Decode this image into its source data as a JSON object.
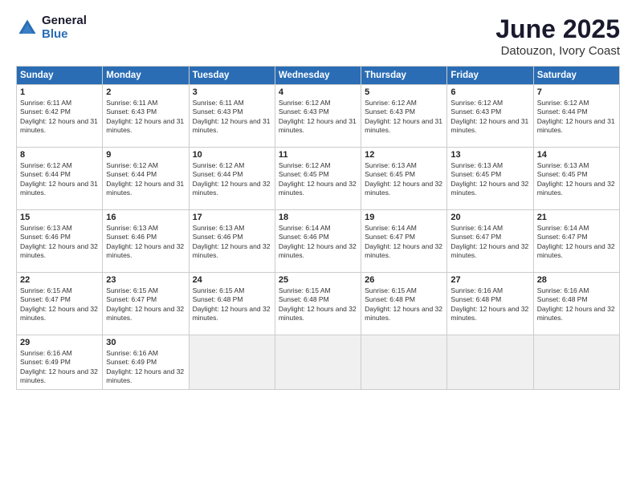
{
  "logo": {
    "general": "General",
    "blue": "Blue"
  },
  "title": "June 2025",
  "subtitle": "Datouzon, Ivory Coast",
  "days_of_week": [
    "Sunday",
    "Monday",
    "Tuesday",
    "Wednesday",
    "Thursday",
    "Friday",
    "Saturday"
  ],
  "weeks": [
    [
      {
        "day": "1",
        "sunrise": "6:11 AM",
        "sunset": "6:42 PM",
        "daylight": "12 hours and 31 minutes."
      },
      {
        "day": "2",
        "sunrise": "6:11 AM",
        "sunset": "6:43 PM",
        "daylight": "12 hours and 31 minutes."
      },
      {
        "day": "3",
        "sunrise": "6:11 AM",
        "sunset": "6:43 PM",
        "daylight": "12 hours and 31 minutes."
      },
      {
        "day": "4",
        "sunrise": "6:12 AM",
        "sunset": "6:43 PM",
        "daylight": "12 hours and 31 minutes."
      },
      {
        "day": "5",
        "sunrise": "6:12 AM",
        "sunset": "6:43 PM",
        "daylight": "12 hours and 31 minutes."
      },
      {
        "day": "6",
        "sunrise": "6:12 AM",
        "sunset": "6:43 PM",
        "daylight": "12 hours and 31 minutes."
      },
      {
        "day": "7",
        "sunrise": "6:12 AM",
        "sunset": "6:44 PM",
        "daylight": "12 hours and 31 minutes."
      }
    ],
    [
      {
        "day": "8",
        "sunrise": "6:12 AM",
        "sunset": "6:44 PM",
        "daylight": "12 hours and 31 minutes."
      },
      {
        "day": "9",
        "sunrise": "6:12 AM",
        "sunset": "6:44 PM",
        "daylight": "12 hours and 31 minutes."
      },
      {
        "day": "10",
        "sunrise": "6:12 AM",
        "sunset": "6:44 PM",
        "daylight": "12 hours and 32 minutes."
      },
      {
        "day": "11",
        "sunrise": "6:12 AM",
        "sunset": "6:45 PM",
        "daylight": "12 hours and 32 minutes."
      },
      {
        "day": "12",
        "sunrise": "6:13 AM",
        "sunset": "6:45 PM",
        "daylight": "12 hours and 32 minutes."
      },
      {
        "day": "13",
        "sunrise": "6:13 AM",
        "sunset": "6:45 PM",
        "daylight": "12 hours and 32 minutes."
      },
      {
        "day": "14",
        "sunrise": "6:13 AM",
        "sunset": "6:45 PM",
        "daylight": "12 hours and 32 minutes."
      }
    ],
    [
      {
        "day": "15",
        "sunrise": "6:13 AM",
        "sunset": "6:46 PM",
        "daylight": "12 hours and 32 minutes."
      },
      {
        "day": "16",
        "sunrise": "6:13 AM",
        "sunset": "6:46 PM",
        "daylight": "12 hours and 32 minutes."
      },
      {
        "day": "17",
        "sunrise": "6:13 AM",
        "sunset": "6:46 PM",
        "daylight": "12 hours and 32 minutes."
      },
      {
        "day": "18",
        "sunrise": "6:14 AM",
        "sunset": "6:46 PM",
        "daylight": "12 hours and 32 minutes."
      },
      {
        "day": "19",
        "sunrise": "6:14 AM",
        "sunset": "6:47 PM",
        "daylight": "12 hours and 32 minutes."
      },
      {
        "day": "20",
        "sunrise": "6:14 AM",
        "sunset": "6:47 PM",
        "daylight": "12 hours and 32 minutes."
      },
      {
        "day": "21",
        "sunrise": "6:14 AM",
        "sunset": "6:47 PM",
        "daylight": "12 hours and 32 minutes."
      }
    ],
    [
      {
        "day": "22",
        "sunrise": "6:15 AM",
        "sunset": "6:47 PM",
        "daylight": "12 hours and 32 minutes."
      },
      {
        "day": "23",
        "sunrise": "6:15 AM",
        "sunset": "6:47 PM",
        "daylight": "12 hours and 32 minutes."
      },
      {
        "day": "24",
        "sunrise": "6:15 AM",
        "sunset": "6:48 PM",
        "daylight": "12 hours and 32 minutes."
      },
      {
        "day": "25",
        "sunrise": "6:15 AM",
        "sunset": "6:48 PM",
        "daylight": "12 hours and 32 minutes."
      },
      {
        "day": "26",
        "sunrise": "6:15 AM",
        "sunset": "6:48 PM",
        "daylight": "12 hours and 32 minutes."
      },
      {
        "day": "27",
        "sunrise": "6:16 AM",
        "sunset": "6:48 PM",
        "daylight": "12 hours and 32 minutes."
      },
      {
        "day": "28",
        "sunrise": "6:16 AM",
        "sunset": "6:48 PM",
        "daylight": "12 hours and 32 minutes."
      }
    ],
    [
      {
        "day": "29",
        "sunrise": "6:16 AM",
        "sunset": "6:49 PM",
        "daylight": "12 hours and 32 minutes."
      },
      {
        "day": "30",
        "sunrise": "6:16 AM",
        "sunset": "6:49 PM",
        "daylight": "12 hours and 32 minutes."
      },
      null,
      null,
      null,
      null,
      null
    ]
  ]
}
